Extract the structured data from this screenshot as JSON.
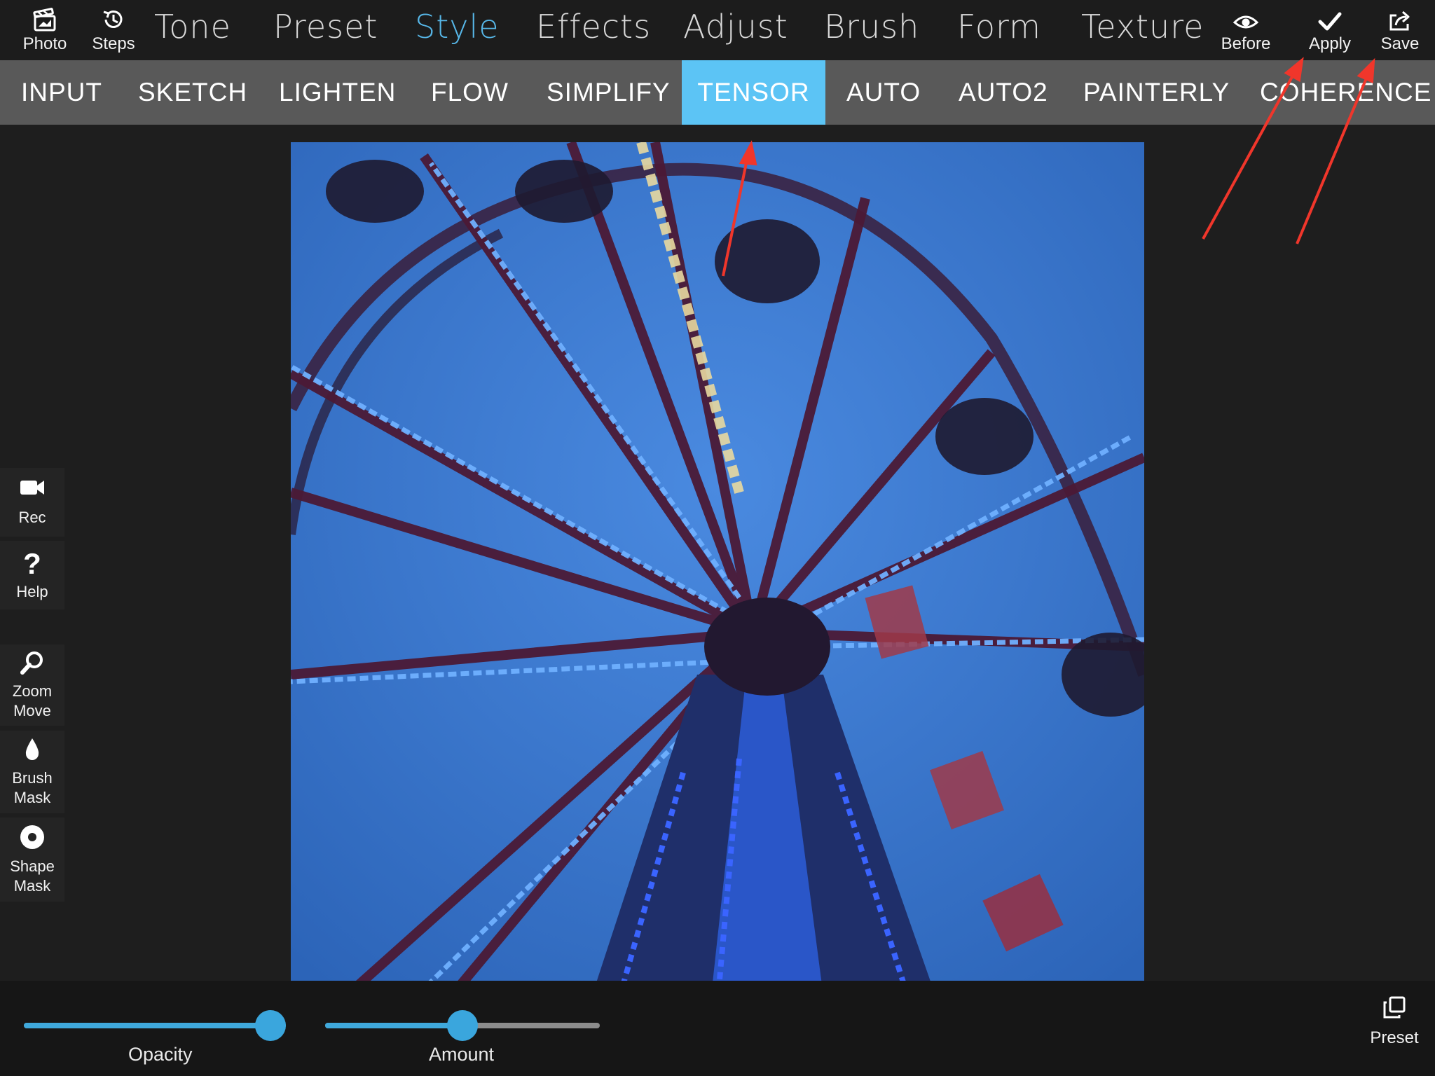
{
  "toolbar": {
    "left_tools": [
      {
        "label": "Photo",
        "icon": "photo-icon"
      },
      {
        "label": "Steps",
        "icon": "history-icon"
      }
    ],
    "main_tabs": [
      {
        "label": "Tone"
      },
      {
        "label": "Preset"
      },
      {
        "label": "Style",
        "active": true
      },
      {
        "label": "Effects"
      },
      {
        "label": "Adjust"
      },
      {
        "label": "Brush"
      },
      {
        "label": "Form"
      },
      {
        "label": "Texture"
      }
    ],
    "right_tools": [
      {
        "label": "Before",
        "icon": "eye-icon"
      },
      {
        "label": "Apply",
        "icon": "checkmark-icon"
      },
      {
        "label": "Save",
        "icon": "share-icon"
      }
    ]
  },
  "style_tabs": [
    {
      "label": "INPUT"
    },
    {
      "label": "SKETCH"
    },
    {
      "label": "LIGHTEN"
    },
    {
      "label": "FLOW"
    },
    {
      "label": "SIMPLIFY"
    },
    {
      "label": "TENSOR",
      "active": true
    },
    {
      "label": "AUTO"
    },
    {
      "label": "AUTO2"
    },
    {
      "label": "PAINTERLY"
    },
    {
      "label": "COHERENCE"
    }
  ],
  "side_tools": [
    {
      "label": "Rec",
      "icon": "video-camera-icon"
    },
    {
      "label": "Help",
      "icon": "question-mark-icon"
    },
    {
      "label": "Zoom Move",
      "icon": "magnifier-icon"
    },
    {
      "label": "Brush Mask",
      "icon": "drop-icon"
    },
    {
      "label": "Shape Mask",
      "icon": "circle-target-icon"
    }
  ],
  "sliders": [
    {
      "label": "Opacity",
      "value": 1.0
    },
    {
      "label": "Amount",
      "value": 0.5
    }
  ],
  "preset_button": {
    "label": "Preset",
    "icon": "duplicate-icon"
  },
  "colors": {
    "accent": "#57b7e8",
    "active_tab": "#5cc4f5",
    "subbar": "#595959",
    "annotation_arrow": "#f0362b"
  }
}
